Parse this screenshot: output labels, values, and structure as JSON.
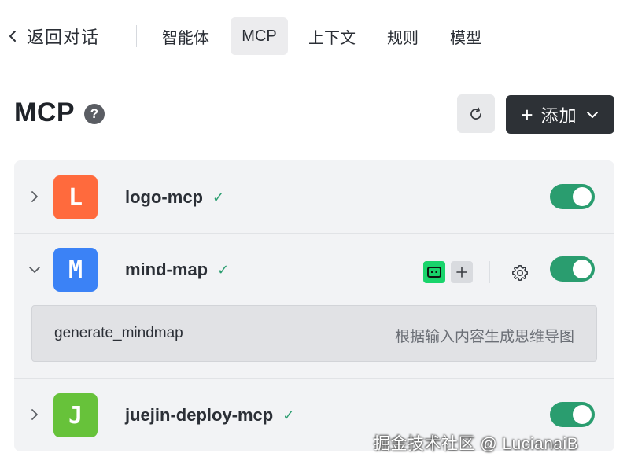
{
  "nav": {
    "back_label": "返回对话",
    "tabs": [
      {
        "label": "智能体",
        "active": false
      },
      {
        "label": "MCP",
        "active": true
      },
      {
        "label": "上下文",
        "active": false
      },
      {
        "label": "规则",
        "active": false
      },
      {
        "label": "模型",
        "active": false
      }
    ]
  },
  "header": {
    "title": "MCP",
    "help_glyph": "?",
    "refresh_icon": "refresh-icon",
    "add_button": {
      "plus": "+",
      "label": "添加",
      "icon": "chevron-down-icon"
    }
  },
  "servers": [
    {
      "letter": "L",
      "name": "logo-mcp",
      "avatar_color": "#ff6a3d",
      "expanded": false,
      "enabled": true,
      "verified": "✓"
    },
    {
      "letter": "M",
      "name": "mind-map",
      "avatar_color": "#3b82f6",
      "expanded": true,
      "enabled": true,
      "verified": "✓",
      "tools": [
        {
          "name": "generate_mindmap",
          "description": "根据输入内容生成思维导图"
        }
      ]
    },
    {
      "letter": "J",
      "name": "juejin-deploy-mcp",
      "avatar_color": "#67c23a",
      "expanded": false,
      "enabled": true,
      "verified": "✓"
    }
  ],
  "colors": {
    "toggle_on": "#2a9d6f",
    "accent_dark": "#2d3136",
    "chip_green": "#19d46b"
  },
  "watermark": "掘金技术社区 @ LucianaiB"
}
